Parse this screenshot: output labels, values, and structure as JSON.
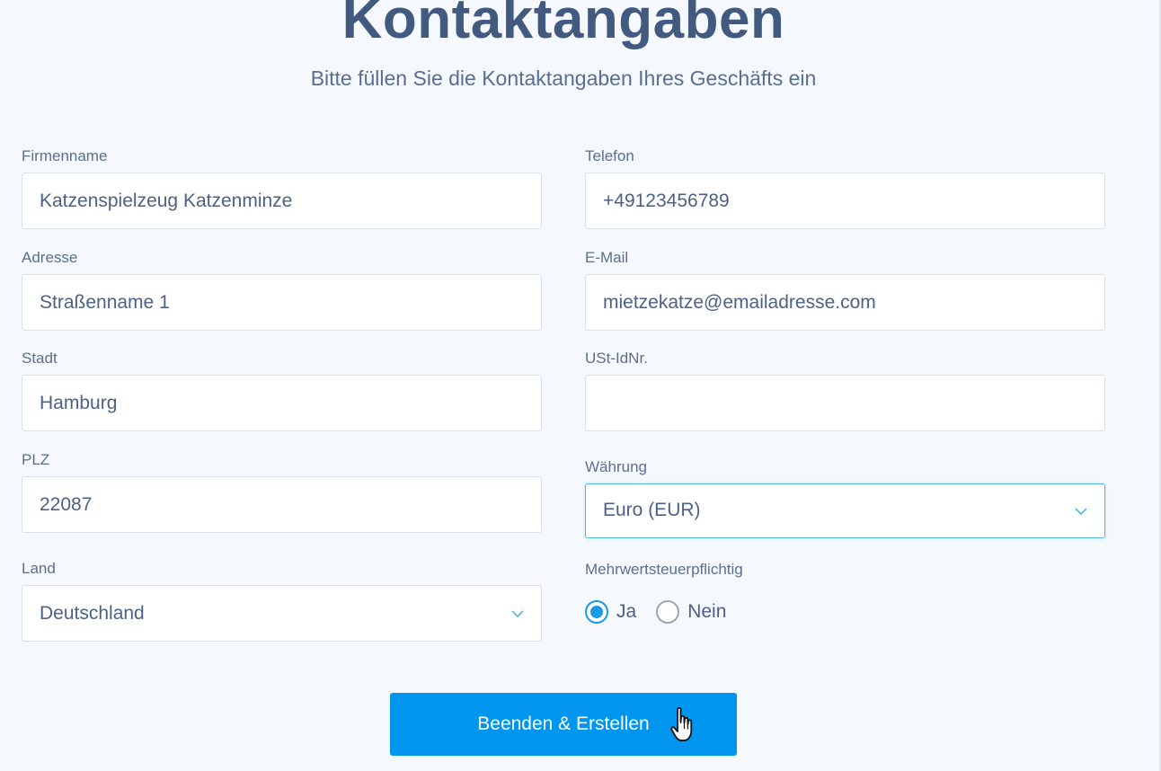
{
  "header": {
    "title": "Kontaktangaben",
    "subtitle": "Bitte füllen Sie die Kontaktangaben Ihres Geschäfts ein"
  },
  "form": {
    "company": {
      "label": "Firmenname",
      "value": "Katzenspielzeug Katzenminze"
    },
    "address": {
      "label": "Adresse",
      "value": "Straßenname 1"
    },
    "city": {
      "label": "Stadt",
      "value": "Hamburg"
    },
    "zip": {
      "label": "PLZ",
      "value": "22087"
    },
    "country": {
      "label": "Land",
      "value": "Deutschland"
    },
    "phone": {
      "label": "Telefon",
      "value": "+49123456789"
    },
    "email": {
      "label": "E-Mail",
      "value": "mietzekatze@emailadresse.com"
    },
    "vat_id": {
      "label": "USt-IdNr.",
      "value": ""
    },
    "currency": {
      "label": "Währung",
      "value": "Euro (EUR)"
    },
    "vat_liable": {
      "label": "Mehrwertsteuerpflichtig",
      "options": [
        {
          "label": "Ja",
          "checked": true
        },
        {
          "label": "Nein",
          "checked": false
        }
      ]
    }
  },
  "submit": {
    "label": "Beenden & Erstellen"
  },
  "colors": {
    "accent": "#0096ef",
    "radio_checked": "#1a9be6",
    "focus_border": "#52b7e8",
    "title": "#435a80",
    "background": "#f5f8fc"
  },
  "icons": {
    "dropdown": "chevron-down-icon",
    "cursor": "hand-pointer-icon"
  }
}
